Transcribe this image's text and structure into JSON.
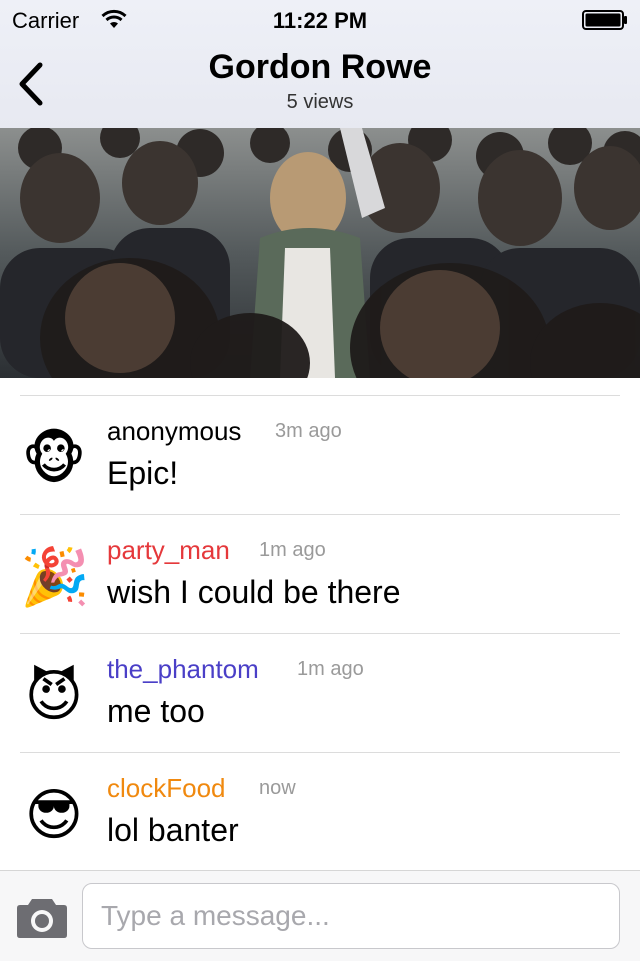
{
  "status_bar": {
    "carrier": "Carrier",
    "time": "11:22 PM"
  },
  "nav": {
    "title": "Gordon Rowe",
    "subtitle": "5 views",
    "back_icon": "chevron-left-icon"
  },
  "hero": {
    "image": "crowd-photo"
  },
  "messages": [
    {
      "avatar": "🐵",
      "avatar_icon": "monkey-face-emoji",
      "username": "anonymous",
      "username_color": "#000000",
      "time": "3m ago",
      "text": "Epic!"
    },
    {
      "avatar": "🎉",
      "avatar_icon": "party-popper-emoji",
      "username": "party_man",
      "username_color": "#e5383b",
      "time": "1m ago",
      "text": "wish I could be there"
    },
    {
      "avatar": "😈",
      "avatar_icon": "smiling-devil-emoji",
      "username": "the_phantom",
      "username_color": "#4a3fc7",
      "time": "1m ago",
      "text": "me too"
    },
    {
      "avatar": "😎",
      "avatar_icon": "sunglasses-face-emoji",
      "username": "clockFood",
      "username_color": "#f0890f",
      "time": "now",
      "text": "lol banter"
    }
  ],
  "input_bar": {
    "placeholder": "Type a message...",
    "value": "",
    "camera_icon": "camera-icon"
  }
}
